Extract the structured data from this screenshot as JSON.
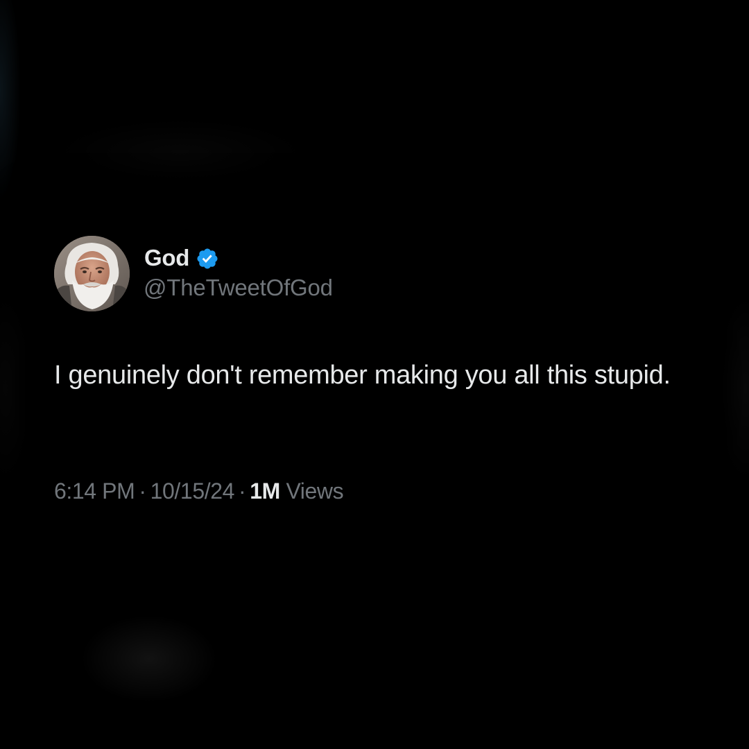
{
  "tweet": {
    "author": {
      "display_name": "God",
      "handle": "@TheTweetOfGod",
      "verified": true,
      "avatar_icon": "avatar-bearded-man"
    },
    "text": "I genuinely don't remember making you all this stupid.",
    "meta": {
      "time": "6:14 PM",
      "date": "10/15/24",
      "separator": "·",
      "views_count": "1M",
      "views_label": "Views"
    }
  },
  "colors": {
    "background": "#000000",
    "primary_text": "#e7e9ea",
    "secondary_text": "#71767b",
    "verified_badge": "#1d9bf0"
  }
}
